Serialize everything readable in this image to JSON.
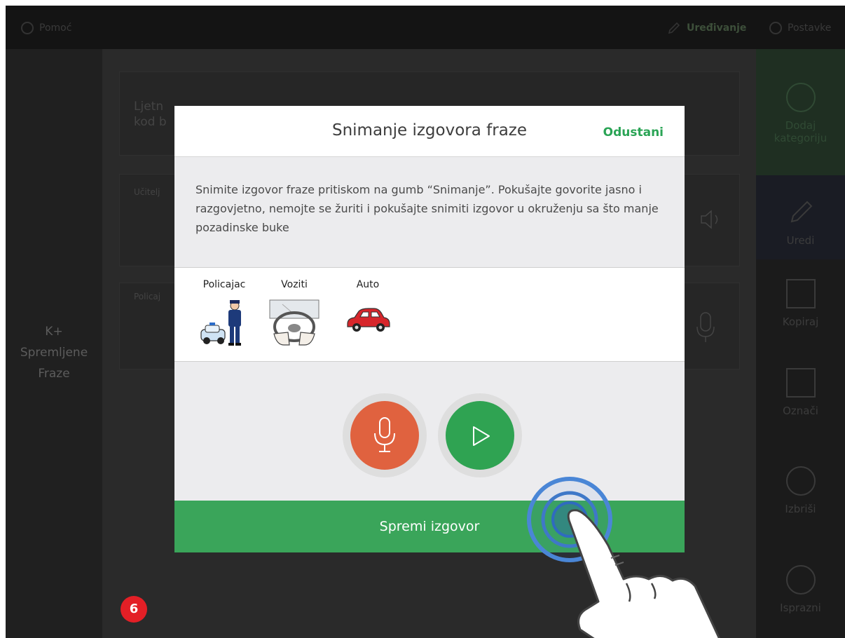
{
  "topbar": {
    "help_label": "Pomoć",
    "edit_label": "Uređivanje",
    "settings_label": "Postavke"
  },
  "leftcol": {
    "label_line1": "K+",
    "label_line2": "Spremljene",
    "label_line3": "Fraze"
  },
  "rightbar": {
    "add_label_1": "Dodaj",
    "add_label_2": "kategoriju",
    "edit_label": "Uredi",
    "copy_label": "Kopiraj",
    "mark_label": "Označi",
    "delete_label": "Izbriši",
    "more_label": "Isprazni"
  },
  "background": {
    "card1_line1": "Ljetn",
    "card1_line2": "kod b",
    "card2_title": "Učitelj",
    "card3_title": "Policaj"
  },
  "modal": {
    "title": "Snimanje izgovora fraze",
    "cancel_label": "Odustani",
    "instructions": "Snimite izgovor fraze pritiskom na gumb “Snimanje”. Pokušajte govorite jasno i razgovjetno, nemojte se žuriti i pokušajte snimiti izgovor u okruženju sa što manje pozadinske buke",
    "symbols": [
      {
        "word": "Policajac",
        "icon": "police-officer-car-icon"
      },
      {
        "word": "Voziti",
        "icon": "steering-wheel-icon"
      },
      {
        "word": "Auto",
        "icon": "red-car-icon"
      }
    ],
    "record_icon": "microphone-icon",
    "play_icon": "play-icon",
    "save_label": "Spremi izgovor"
  },
  "step_badge": "6",
  "colors": {
    "accent_green": "#3aa55a",
    "record_red": "#e0623f",
    "play_green": "#2fa352",
    "badge_red": "#e31f26"
  }
}
